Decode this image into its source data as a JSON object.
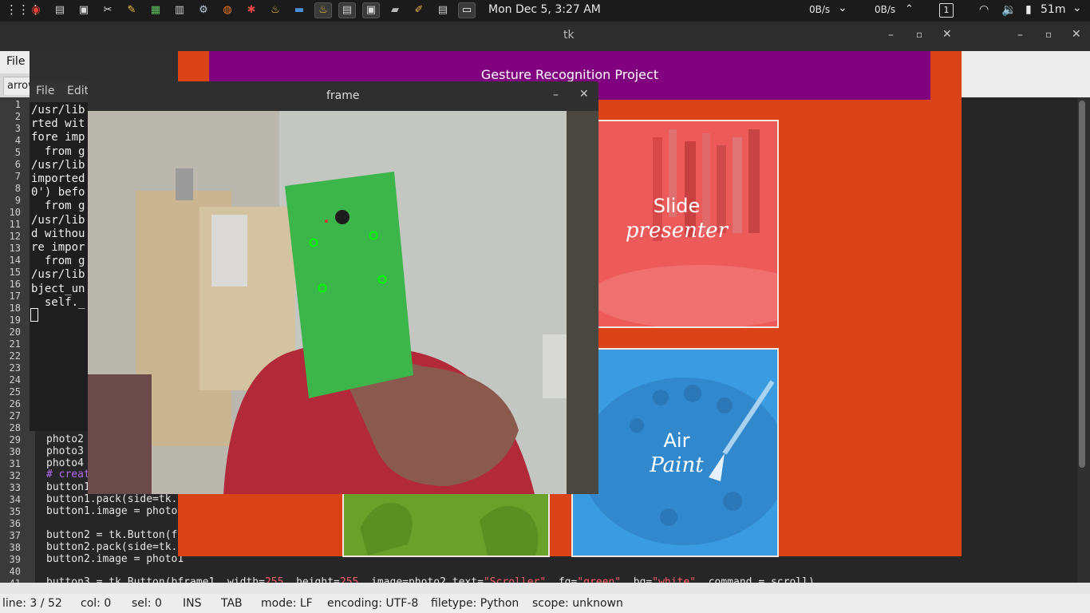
{
  "top_panel": {
    "apps_icon": "grid-icon",
    "launchers": [
      {
        "name": "chrome-icon",
        "glyph": "◉",
        "color": "#e34133"
      },
      {
        "name": "files-icon",
        "glyph": "▤",
        "color": "#cfcfcf"
      },
      {
        "name": "terminal-icon",
        "glyph": "▣",
        "color": "#dcdcdc"
      },
      {
        "name": "tools-icon",
        "glyph": "✂",
        "color": "#e0e0e0"
      },
      {
        "name": "editor-icon",
        "glyph": "✎",
        "color": "#f0c040"
      },
      {
        "name": "monitor-icon",
        "glyph": "▦",
        "color": "#5fbf5f"
      },
      {
        "name": "calculator-icon",
        "glyph": "▥",
        "color": "#cccccc"
      },
      {
        "name": "settings-icon",
        "glyph": "⚙",
        "color": "#bcd"
      },
      {
        "name": "firefox-icon",
        "glyph": "◍",
        "color": "#f07a1a"
      },
      {
        "name": "tools2-icon",
        "glyph": "✱",
        "color": "#e04848"
      },
      {
        "name": "jug-icon",
        "glyph": "♨",
        "color": "#f3c535"
      },
      {
        "name": "remote-icon",
        "glyph": "▬",
        "color": "#4a90d9"
      }
    ],
    "windows": [
      {
        "name": "python-window-icon",
        "glyph": "♨",
        "color": "#f3c535",
        "selected": true
      },
      {
        "name": "geany-window-icon",
        "glyph": "▤",
        "color": "#cfcfcf",
        "selected": true
      },
      {
        "name": "terminal-window-icon",
        "glyph": "▣",
        "color": "#dcdcdc",
        "selected": true
      },
      {
        "name": "drive-window-icon",
        "glyph": "▰",
        "color": "#bbbbbb",
        "selected": false
      },
      {
        "name": "paint-window-icon",
        "glyph": "✐",
        "color": "#e8b04a",
        "selected": false
      },
      {
        "name": "files-window-icon",
        "glyph": "▤",
        "color": "#cfcfcf",
        "selected": false
      },
      {
        "name": "screenshot-window-icon",
        "glyph": "▭",
        "color": "#f2f2f2",
        "selected": true
      }
    ],
    "clock": "Mon Dec  5,  3:27 AM",
    "net_down": "0B/s",
    "net_up": "0B/s",
    "workspace": "1",
    "battery": "51m"
  },
  "geany": {
    "menu_file": "File",
    "tab_label": "arrow",
    "line_numbers": [
      "1",
      "2",
      "3",
      "4",
      "5",
      "6",
      "7",
      "8",
      "9",
      "10",
      "11",
      "12",
      "13",
      "14",
      "15",
      "16",
      "17",
      "18",
      "19",
      "20",
      "21",
      "22",
      "23",
      "24",
      "25",
      "26",
      "27",
      "28",
      "29",
      "30",
      "31",
      "32",
      "33",
      "34",
      "35",
      "36",
      "37",
      "38",
      "39",
      "40",
      "41"
    ],
    "code": [
      {
        "n": 29,
        "text": "photo2"
      },
      {
        "n": 30,
        "text": "photo3"
      },
      {
        "n": 31,
        "text": "photo4"
      },
      {
        "n": 33,
        "text": "button1"
      },
      {
        "n": 34,
        "text": "button1.pack(side=tk."
      },
      {
        "n": 35,
        "text": "button1.image = photo"
      },
      {
        "n": 37,
        "text": "button2 = tk.Button(f"
      },
      {
        "n": 38,
        "text": "button2.pack(side=tk."
      },
      {
        "n": 39,
        "text": "button2.image = photo1"
      }
    ],
    "comment_line": "# creat",
    "line41": {
      "a": "button3 = tk.Button(bframe1, width=",
      "b": "255",
      "c": ", height=",
      "d": "255",
      "e": ", image=photo2,text=",
      "f": "\"Scroller\"",
      "g": ", fg=",
      "h": "\"green\"",
      "i": ", bg=",
      "j": "\"white\"",
      "k": ", command = scroll)"
    },
    "status": {
      "line": "line: 3 / 52",
      "col": "col: 0",
      "sel": "sel: 0",
      "ins": "INS",
      "tab": "TAB",
      "mode": "mode: LF",
      "encoding": "encoding: UTF-8",
      "filetype": "filetype: Python",
      "scope": "scope: unknown"
    }
  },
  "terminal": {
    "menu_file": "File",
    "menu_edit": "Edit",
    "lines": [
      "/usr/lib",
      "rted wit",
      "fore imp",
      "  from g",
      "/usr/lib",
      "imported",
      "0') befo",
      "  from g",
      "/usr/lib",
      "d withou",
      "re impor",
      "  from g",
      "/usr/lib",
      "bject_un",
      "  self._"
    ]
  },
  "tk_window": {
    "title": "tk",
    "header": "Gesture Recognition Project",
    "cards": [
      {
        "id": "slide",
        "line1": "Slide",
        "line2": "presenter",
        "color": "#ec5a5a"
      },
      {
        "id": "air",
        "line1": "Air",
        "line2": "Paint",
        "color": "#3a9be0"
      },
      {
        "id": "scroller",
        "line1": "",
        "line2": "",
        "color": "#6aa12a"
      }
    ]
  },
  "frame_window": {
    "title": "frame"
  },
  "colors": {
    "tk_bg": "#d94317",
    "header_purple": "#800080",
    "tracking_green": "#00ff00"
  }
}
